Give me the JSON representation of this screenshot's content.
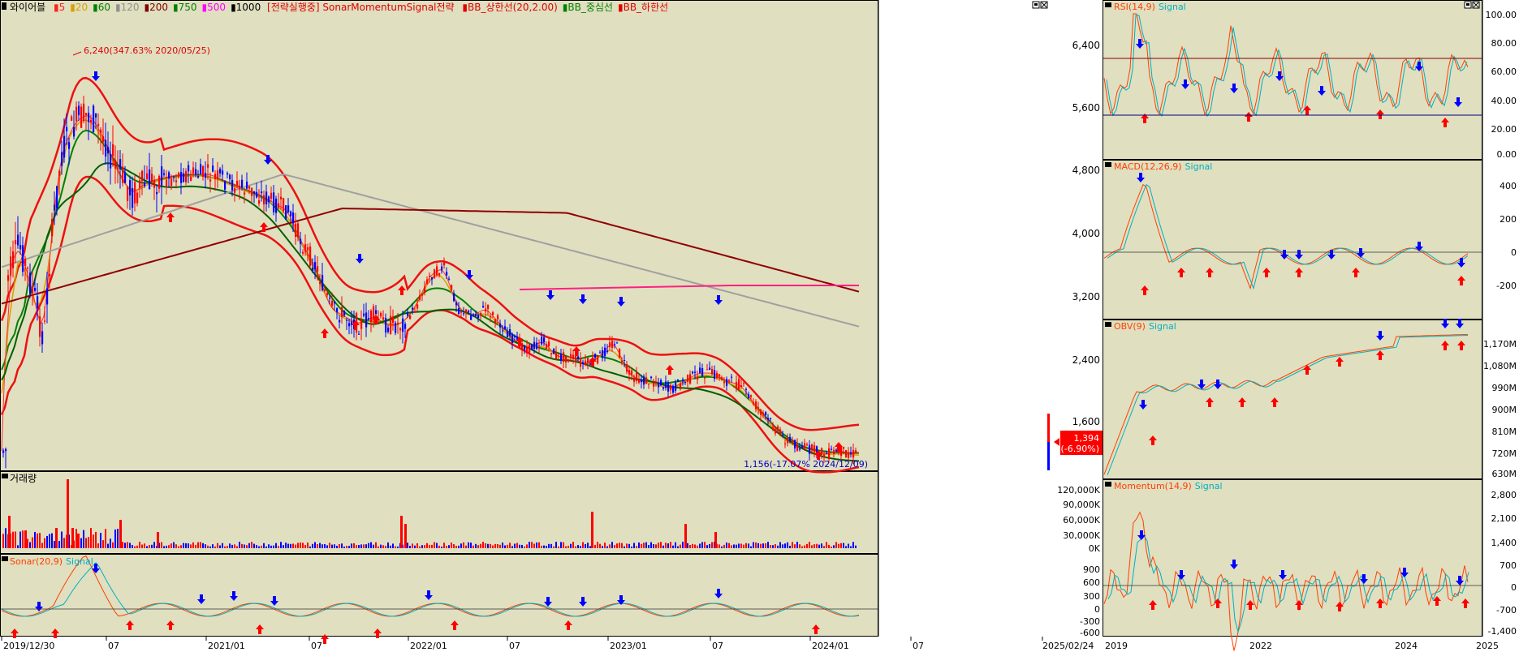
{
  "main_chart": {
    "title": "와이어블",
    "legend_items": [
      {
        "label": "5",
        "color": "#ff2020"
      },
      {
        "label": "20",
        "color": "#d8a000"
      },
      {
        "label": "60",
        "color": "#008000"
      },
      {
        "label": "120",
        "color": "#909090"
      },
      {
        "label": "200",
        "color": "#800000"
      },
      {
        "label": "750",
        "color": "#008000"
      },
      {
        "label": "500",
        "color": "#ff00ff"
      },
      {
        "label": "1000",
        "color": "#000000"
      }
    ],
    "strategy_label": "[전략실행중] SonarMomentumSignal전략",
    "bb_labels": [
      {
        "label": "BB_상한선(20,2.00)",
        "color": "#e00000"
      },
      {
        "label": "BB_중심선",
        "color": "#008000"
      },
      {
        "label": "BB_하한선",
        "color": "#e00000"
      }
    ],
    "high_annotation": "6,240(347.63% 2020/05/25)",
    "low_annotation": "1,156(-17.07% 2024/12/09)",
    "price_axis": [
      "6,400",
      "5,600",
      "4,800",
      "4,000",
      "3,200",
      "2,400",
      "1,600"
    ],
    "current_price": "1,394",
    "current_change": "(-6.90%)"
  },
  "volume_panel": {
    "title": "거래량",
    "axis": [
      "120,000K",
      "90,000K",
      "60,000K",
      "30,000K",
      "0K"
    ]
  },
  "sonar_panel": {
    "title": "Sonar(20,9)",
    "signal_label": "Signal",
    "axis": [
      "900",
      "600",
      "300",
      "0",
      "-300",
      "-600"
    ]
  },
  "x_axis": {
    "labels": [
      "2019/12/30",
      "07",
      "2021/01",
      "07",
      "2022/01",
      "07",
      "2023/01",
      "07",
      "2024/01",
      "07",
      "2025/02/24"
    ]
  },
  "rsi_panel": {
    "title": "RSI(14,9)",
    "signal_label": "Signal",
    "axis": [
      "100.00",
      "80.00",
      "60.00",
      "40.00",
      "20.00",
      "0.00"
    ]
  },
  "macd_panel": {
    "title": "MACD(12,26,9)",
    "signal_label": "Signal",
    "axis": [
      "400",
      "200",
      "0",
      "-200"
    ]
  },
  "obv_panel": {
    "title": "OBV(9)",
    "signal_label": "Signal",
    "axis": [
      "1,170M",
      "1,080M",
      "990M",
      "900M",
      "810M",
      "720M",
      "630M"
    ]
  },
  "momentum_panel": {
    "title": "Momentum(14,9)",
    "signal_label": "Signal",
    "axis": [
      "2,800",
      "2,100",
      "1,400",
      "700",
      "0",
      "-700",
      "-1,400"
    ]
  },
  "right_x_axis": {
    "labels": [
      "2019",
      "2022",
      "2024",
      "2025"
    ]
  },
  "colors": {
    "background": "#e0dfc0",
    "up": "#ff0000",
    "down": "#0000ff",
    "signal": "#00b0c0",
    "indicator": "#ff4000"
  }
}
